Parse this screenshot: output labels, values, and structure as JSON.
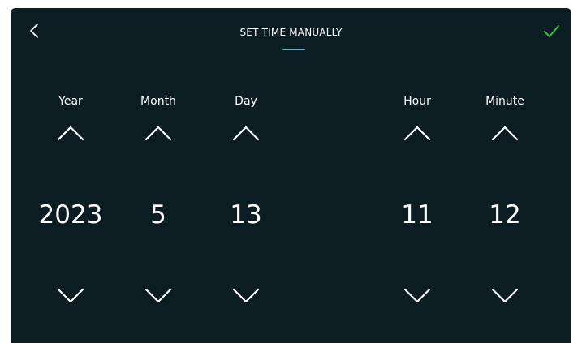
{
  "header": {
    "title": "SET TIME MANUALLY",
    "back_icon": "chevron-left-icon",
    "confirm_icon": "checkmark-icon",
    "accent_color": "#3fbf4a",
    "underline_color": "#6fb3c4"
  },
  "pickers": {
    "year": {
      "label": "Year",
      "value": "2023"
    },
    "month": {
      "label": "Month",
      "value": "5"
    },
    "day": {
      "label": "Day",
      "value": "13"
    },
    "hour": {
      "label": "Hour",
      "value": "11"
    },
    "minute": {
      "label": "Minute",
      "value": "12"
    }
  },
  "icons": {
    "increment": "chevron-up-icon",
    "decrement": "chevron-down-icon"
  },
  "colors": {
    "background": "#0b1c22",
    "text": "#ffffff"
  }
}
